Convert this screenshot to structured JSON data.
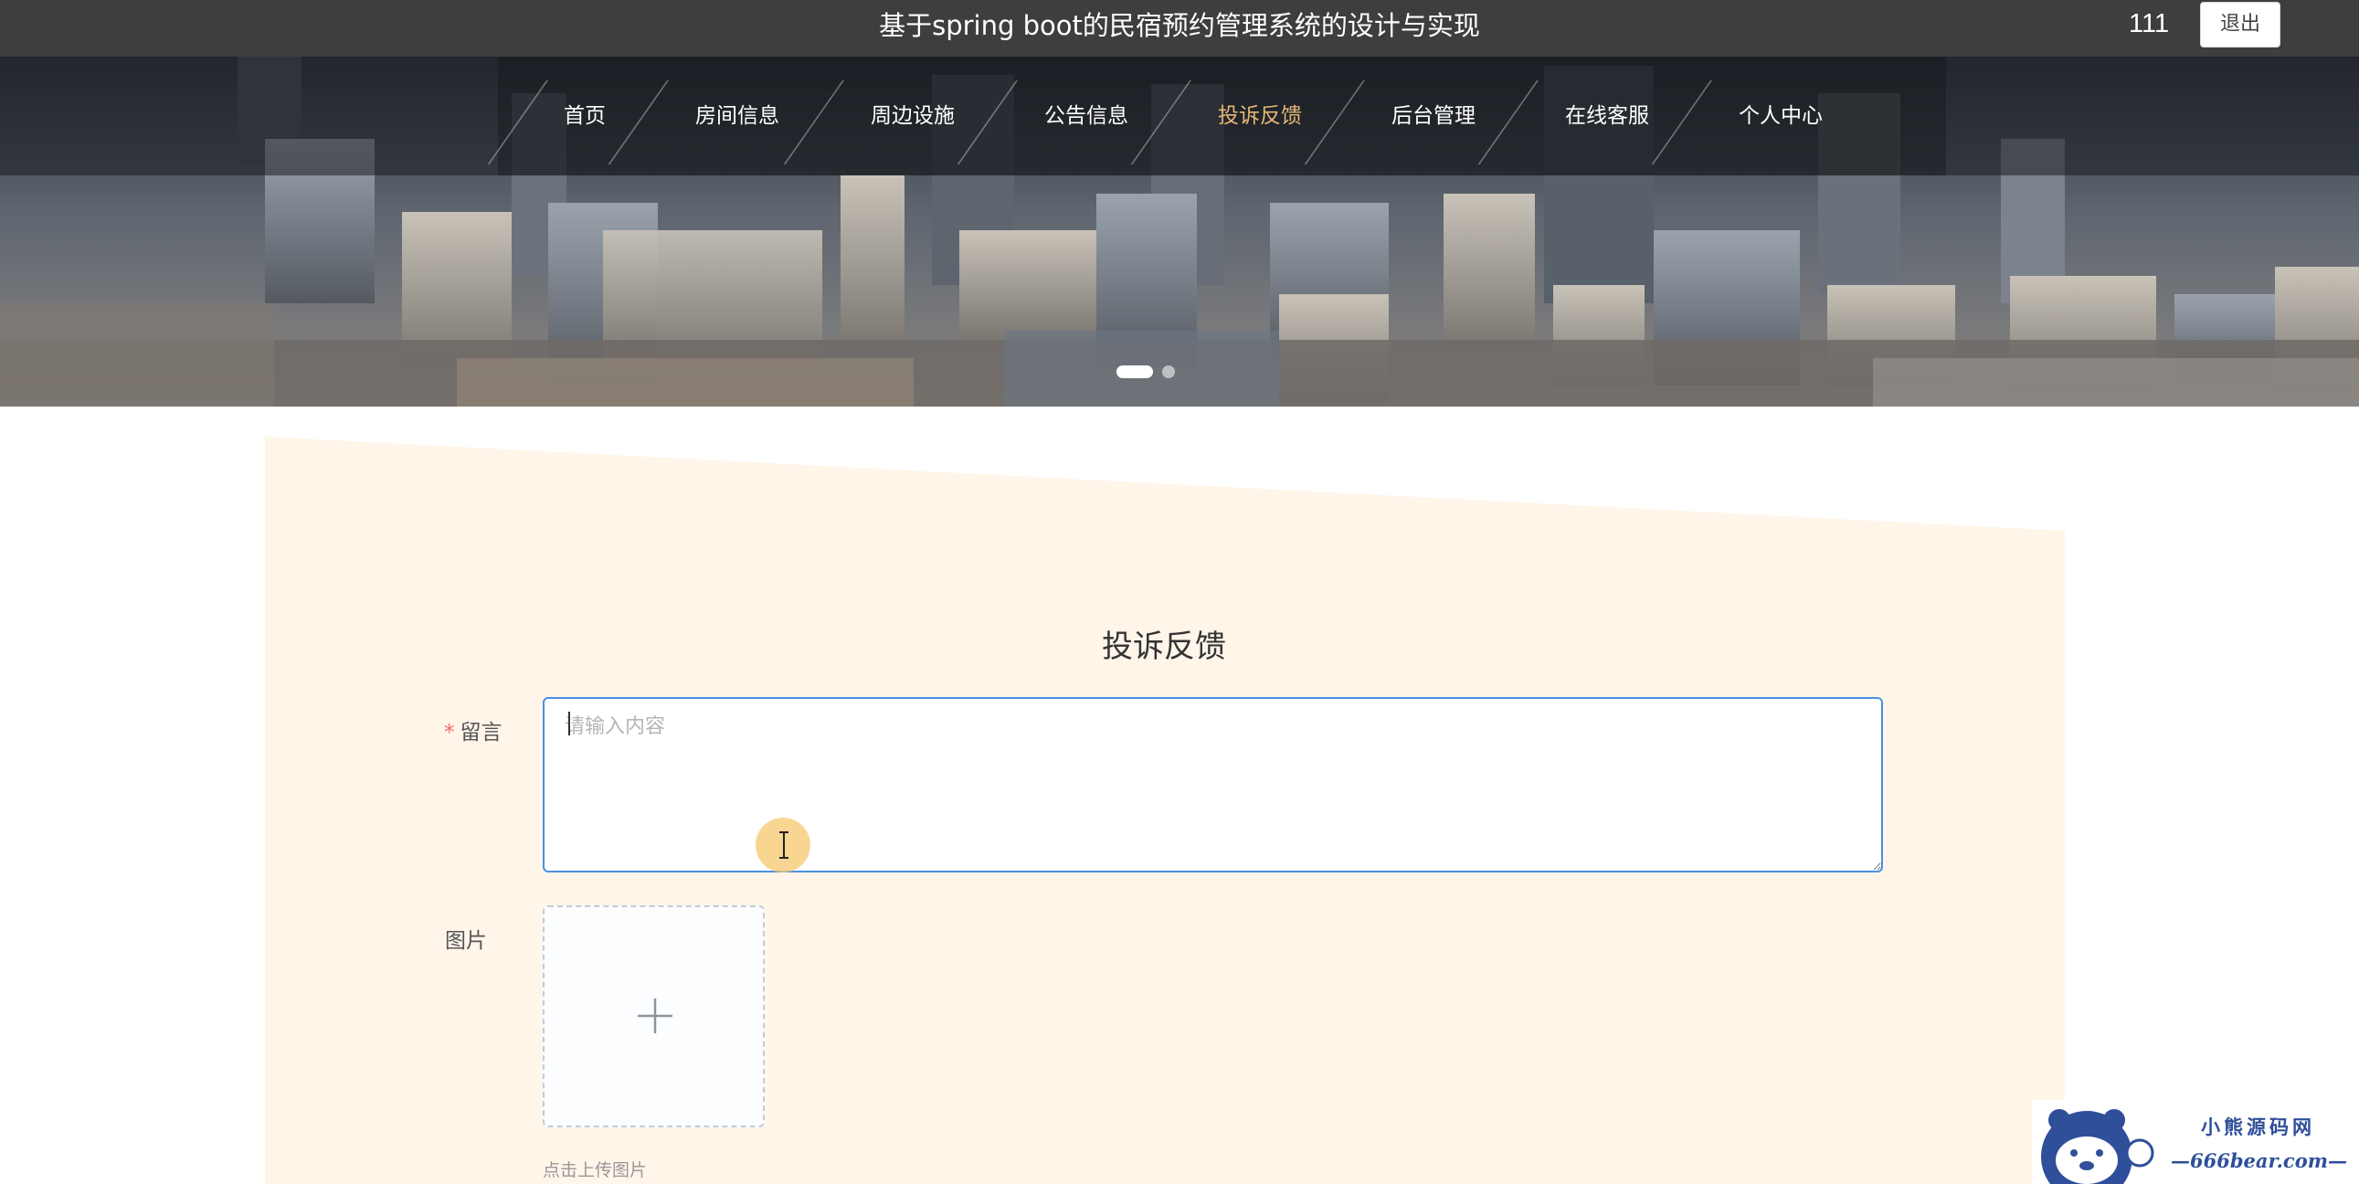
{
  "header": {
    "site_title": "基于spring boot的民宿预约管理系统的设计与实现",
    "username": "111",
    "logout_label": "退出"
  },
  "nav": {
    "items": [
      {
        "label": "首页"
      },
      {
        "label": "房间信息"
      },
      {
        "label": "周边设施"
      },
      {
        "label": "公告信息"
      },
      {
        "label": "投诉反馈"
      },
      {
        "label": "后台管理"
      },
      {
        "label": "在线客服"
      },
      {
        "label": "个人中心"
      }
    ],
    "active_item": "投诉反馈",
    "active_color": "#e3b778"
  },
  "form": {
    "title": "投诉反馈",
    "message": {
      "label": "留言",
      "required_mark": "*",
      "placeholder": "请输入内容",
      "value": ""
    },
    "image": {
      "label": "图片",
      "upload_hint": "点击上传图片",
      "icon": "plus-icon"
    }
  },
  "watermark": {
    "line1": "小熊源码网",
    "line2": "—666bear.com—"
  },
  "colors": {
    "topbar": "#3e3e3e",
    "panel_bg": "#fff5e9",
    "input_border_focus": "#4a90e2",
    "required": "#f56c6c"
  }
}
